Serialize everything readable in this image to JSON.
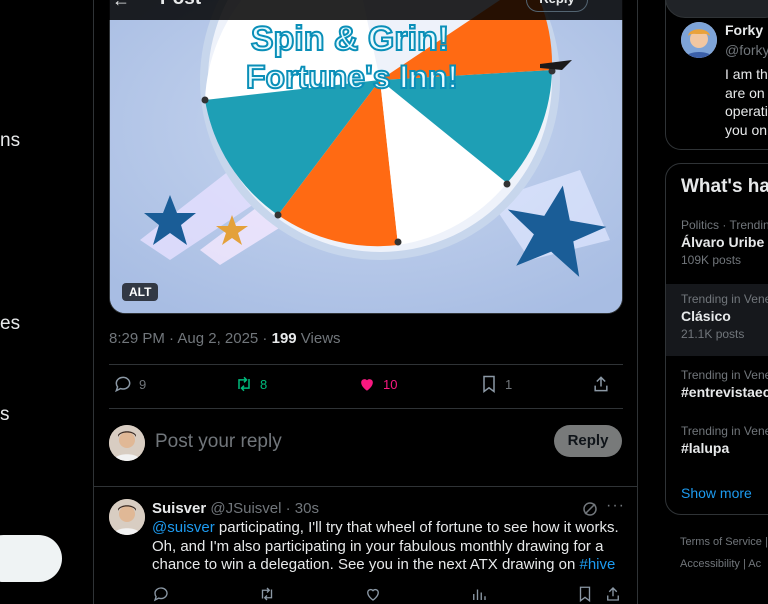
{
  "left_nav": {
    "frag1": "ns",
    "frag2": "es",
    "frag3": "s"
  },
  "topbar": {
    "title": "Post",
    "reply_pill": "Reply"
  },
  "media": {
    "image_text_line1": "Spin & Grin!",
    "image_text_line2": "Fortune's Inn!",
    "alt_badge": "ALT"
  },
  "post_meta": {
    "time": "8:29 PM · Aug 2, 2025 · ",
    "views_count": "199",
    "views_label": " Views"
  },
  "actions": {
    "replies": "9",
    "reposts": "8",
    "likes": "10",
    "bookmarks": "1",
    "colors": {
      "repost": "#00ba7c",
      "like": "#f91880",
      "muted": "#71767b"
    }
  },
  "reply_box": {
    "placeholder": "Post your reply",
    "button": "Reply"
  },
  "comment": {
    "name": "Suisver",
    "handle": "@JSuisvel · 30s",
    "mention": "@suisver",
    "text_part1": " participating, I'll try that wheel of fortune to see how it works. Oh, and I'm also participating in your fabulous monthly drawing for a chance to win a delegation. See you in the next ATX drawing on ",
    "hashtag": "#hive"
  },
  "right": {
    "user_card": {
      "name": "Forky |",
      "handle": "@forky",
      "line1": "I am th",
      "line2": "are on",
      "line3": "operati",
      "line4": "you on"
    },
    "trends_title": "What's ha",
    "trends": [
      {
        "context": "Politics · Trendin",
        "title": "Álvaro Uribe",
        "count": "109K posts"
      },
      {
        "context": "Trending in Vene",
        "title": "Clásico",
        "count": "21.1K posts"
      },
      {
        "context": "Trending in Vene",
        "title": "#entrevistaec",
        "count": ""
      },
      {
        "context": "Trending in Vene",
        "title": "#lalupa",
        "count": ""
      }
    ],
    "show_more": "Show more",
    "footer1": "Terms of Service  |",
    "footer2": "Accessibility  |  Ac"
  }
}
